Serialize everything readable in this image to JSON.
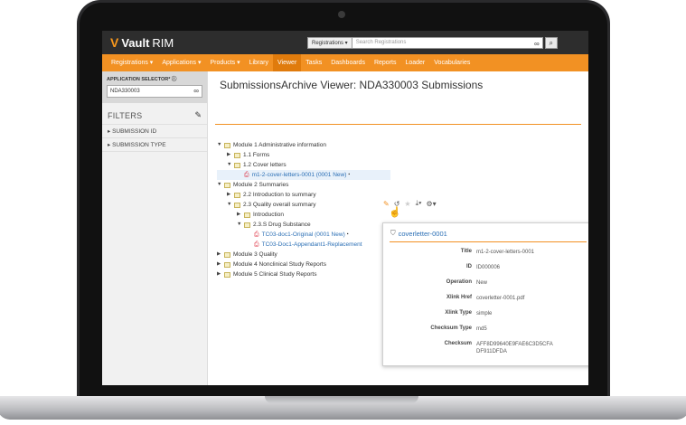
{
  "app": {
    "logo_name": "Vault",
    "logo_suffix": "RIM"
  },
  "search": {
    "scope": "Registrations ▾",
    "placeholder": "Search Registrations"
  },
  "nav": [
    "Registrations ▾",
    "Applications ▾",
    "Products ▾",
    "Library",
    "Viewer",
    "Tasks",
    "Dashboards",
    "Reports",
    "Loader",
    "Vocabularies"
  ],
  "nav_active_index": 4,
  "sidebar": {
    "app_selector_label": "APPLICATION SELECTOR* ⓘ",
    "app_selector_value": "NDA330003",
    "filters_title": "FILTERS",
    "filters": [
      "▸ SUBMISSION ID",
      "▸ SUBMISSION TYPE"
    ]
  },
  "main": {
    "title": "SubmissionsArchive Viewer: NDA330003 Submissions"
  },
  "tree": [
    {
      "indent": 0,
      "caret": "▼",
      "icon": "folder",
      "label": "Module 1 Administrative information"
    },
    {
      "indent": 1,
      "caret": "▶",
      "icon": "folder",
      "label": "1.1 Forms"
    },
    {
      "indent": 1,
      "caret": "▼",
      "icon": "folder",
      "label": "1.2 Cover letters"
    },
    {
      "indent": 2,
      "caret": "",
      "icon": "doc",
      "label": "m1-2-cover-letters-0001 (0001 New)",
      "link": true,
      "lock": true,
      "highlight": true
    },
    {
      "indent": 0,
      "caret": "▼",
      "icon": "folder",
      "label": "Module 2 Summaries"
    },
    {
      "indent": 1,
      "caret": "▶",
      "icon": "folder",
      "label": "2.2 Introduction to summary"
    },
    {
      "indent": 1,
      "caret": "▼",
      "icon": "folder",
      "label": "2.3 Quality overall summary"
    },
    {
      "indent": 2,
      "caret": "▶",
      "icon": "folder",
      "label": "Introduction"
    },
    {
      "indent": 2,
      "caret": "▼",
      "icon": "folder",
      "label": "2.3.S Drug Substance"
    },
    {
      "indent": 3,
      "caret": "",
      "icon": "doc",
      "label": "TC03-doc1-Original (0001 New)",
      "link": true,
      "lock": true
    },
    {
      "indent": 3,
      "caret": "",
      "icon": "doc",
      "label": "TC03-Doc1-Appendant1-Replacement",
      "link": true
    },
    {
      "indent": 0,
      "caret": "▶",
      "icon": "folder",
      "label": "Module 3 Quality"
    },
    {
      "indent": 0,
      "caret": "▶",
      "icon": "folder",
      "label": "Module 4 Nonclinical Study Reports"
    },
    {
      "indent": 0,
      "caret": "▶",
      "icon": "folder",
      "label": "Module 5 Clinical Study Reports"
    }
  ],
  "popup": {
    "title": "coverletter-0001",
    "fields": [
      {
        "k": "Title",
        "v": "m1-2-cover-letters-0001"
      },
      {
        "k": "ID",
        "v": "ID000006"
      },
      {
        "k": "Operation",
        "v": "New"
      },
      {
        "k": "Xlink Href",
        "v": "coverletter-0001.pdf"
      },
      {
        "k": "Xlink Type",
        "v": "simple"
      },
      {
        "k": "Checksum Type",
        "v": "md5"
      },
      {
        "k": "Checksum",
        "v": "AFF8D99640E9FAE6C3D5CFA DF911DFDA"
      }
    ]
  },
  "colors": {
    "accent": "#f29123",
    "topbar": "#2d2d2d",
    "link": "#2b6fb5"
  }
}
